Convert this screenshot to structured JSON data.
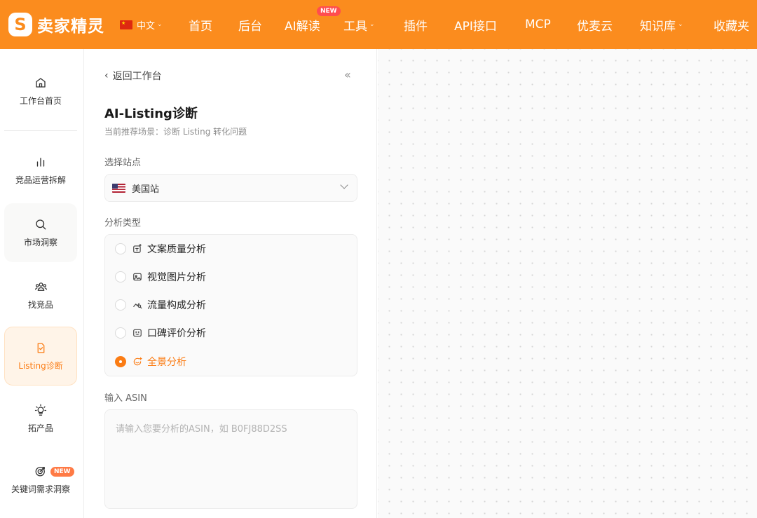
{
  "header": {
    "logo_letter": "S",
    "brand": "卖家精灵",
    "language": "中文",
    "nav": [
      {
        "label": "首页"
      },
      {
        "label": "后台"
      },
      {
        "label": "AI解读",
        "badge": "NEW"
      },
      {
        "label": "工具",
        "dropdown": true
      },
      {
        "label": "插件"
      },
      {
        "label": "API接口"
      },
      {
        "label": "MCP"
      },
      {
        "label": "优麦云"
      },
      {
        "label": "知识库",
        "dropdown": true
      },
      {
        "label": "收藏夹"
      }
    ]
  },
  "sidebar": {
    "items": [
      {
        "label": "工作台首页",
        "icon": "home-icon"
      },
      {
        "label": "竞品运营拆解",
        "icon": "bar-chart-icon"
      },
      {
        "label": "市场洞察",
        "icon": "search-icon"
      },
      {
        "label": "找竞品",
        "icon": "users-icon"
      },
      {
        "label": "Listing诊断",
        "icon": "document-check-icon",
        "active": true
      },
      {
        "label": "拓产品",
        "icon": "lightbulb-icon"
      },
      {
        "label": "关键词需求洞察",
        "icon": "target-icon",
        "badge": "NEW"
      }
    ]
  },
  "panel": {
    "back_label": "返回工作台",
    "title": "AI-Listing诊断",
    "subtitle": "当前推荐场景：诊断 Listing 转化问题",
    "site_label": "选择站点",
    "site_value": "美国站",
    "analysis_label": "分析类型",
    "analysis_options": [
      {
        "label": "文案质量分析",
        "selected": false
      },
      {
        "label": "视觉图片分析",
        "selected": false
      },
      {
        "label": "流量构成分析",
        "selected": false
      },
      {
        "label": "口碑评价分析",
        "selected": false
      },
      {
        "label": "全景分析",
        "selected": true
      }
    ],
    "asin_label": "输入 ASIN",
    "asin_placeholder": "请输入您要分析的ASIN，如 B0FJ88D2SS",
    "asin_value": ""
  },
  "colors": {
    "brand_orange": "#fb8c1e",
    "accent_orange": "#fb7c14",
    "badge_red": "#ff4d4f"
  }
}
